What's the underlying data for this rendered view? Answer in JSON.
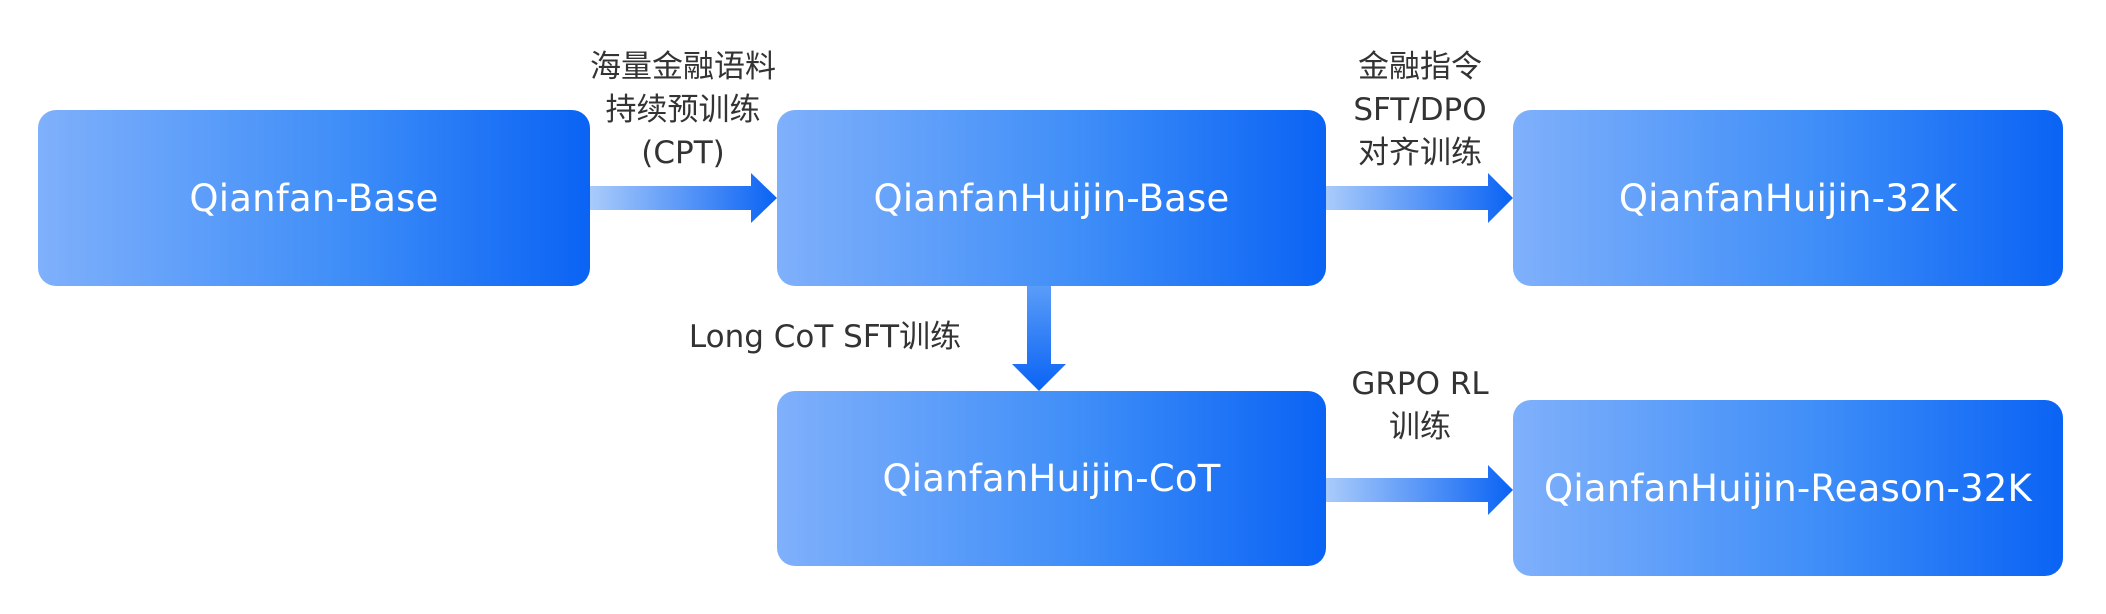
{
  "nodes": {
    "qianfan_base": "Qianfan-Base",
    "huijin_base": "QianfanHuijin-Base",
    "huijin_32k": "QianfanHuijin-32K",
    "huijin_cot": "QianfanHuijin-CoT",
    "huijin_reason": "QianfanHuijin-Reason-32K"
  },
  "edges": {
    "cpt": [
      "海量金融语料",
      "持续预训练",
      "(CPT)"
    ],
    "sft_dpo": [
      "金融指令",
      "SFT/DPO",
      "对齐训练"
    ],
    "long_cot": "Long CoT SFT训练",
    "grpo": [
      "GRPO RL",
      "训练"
    ]
  },
  "colors": {
    "node_gradient_start": "#7fb0fb",
    "node_gradient_end": "#0a63f4",
    "arrow_start": "#9cc2fb",
    "arrow_end": "#0a63f4",
    "label_text": "#333333"
  }
}
